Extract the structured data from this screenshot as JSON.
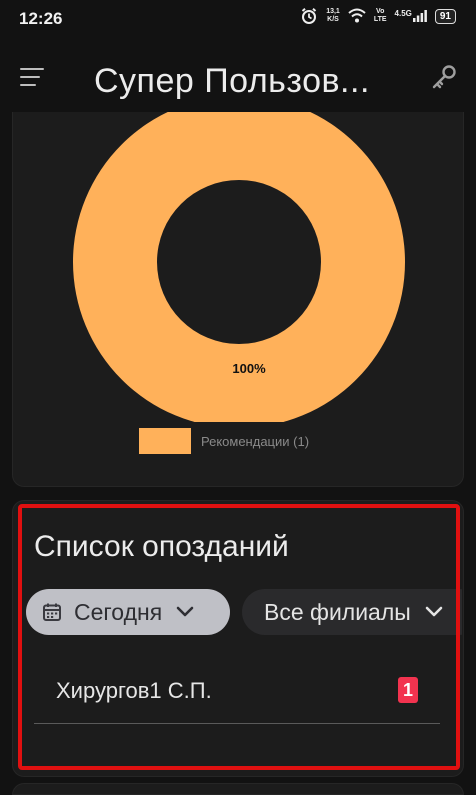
{
  "status_bar": {
    "time": "12:26",
    "speed_value": "13,1",
    "speed_unit": "K/S",
    "volte_top": "Vo",
    "volte_bottom": "LTE",
    "network": "4.5G",
    "battery": "91"
  },
  "app_bar": {
    "title": "Супер Пользов...",
    "menu_icon": "menu-icon",
    "key_icon": "key-icon"
  },
  "chart_data": {
    "type": "pie",
    "variant": "donut",
    "categories": [
      "Рекомендации"
    ],
    "values": [
      1
    ],
    "data_labels": [
      "100%"
    ],
    "legend": [
      "Рекомендации (1)"
    ],
    "colors": [
      "#ffb15a"
    ],
    "legend_position": "bottom"
  },
  "lateness": {
    "title": "Список опозданий",
    "filter_date": "Сегодня",
    "filter_branches": "Все филиалы",
    "items": [
      {
        "name": "Хирургов1 С.П.",
        "count": "1"
      }
    ]
  },
  "colors": {
    "background": "#121212",
    "card": "#1c1c1c",
    "accent_orange": "#ffb15a",
    "badge_red": "#f2334f",
    "highlight_red": "#e01010"
  }
}
